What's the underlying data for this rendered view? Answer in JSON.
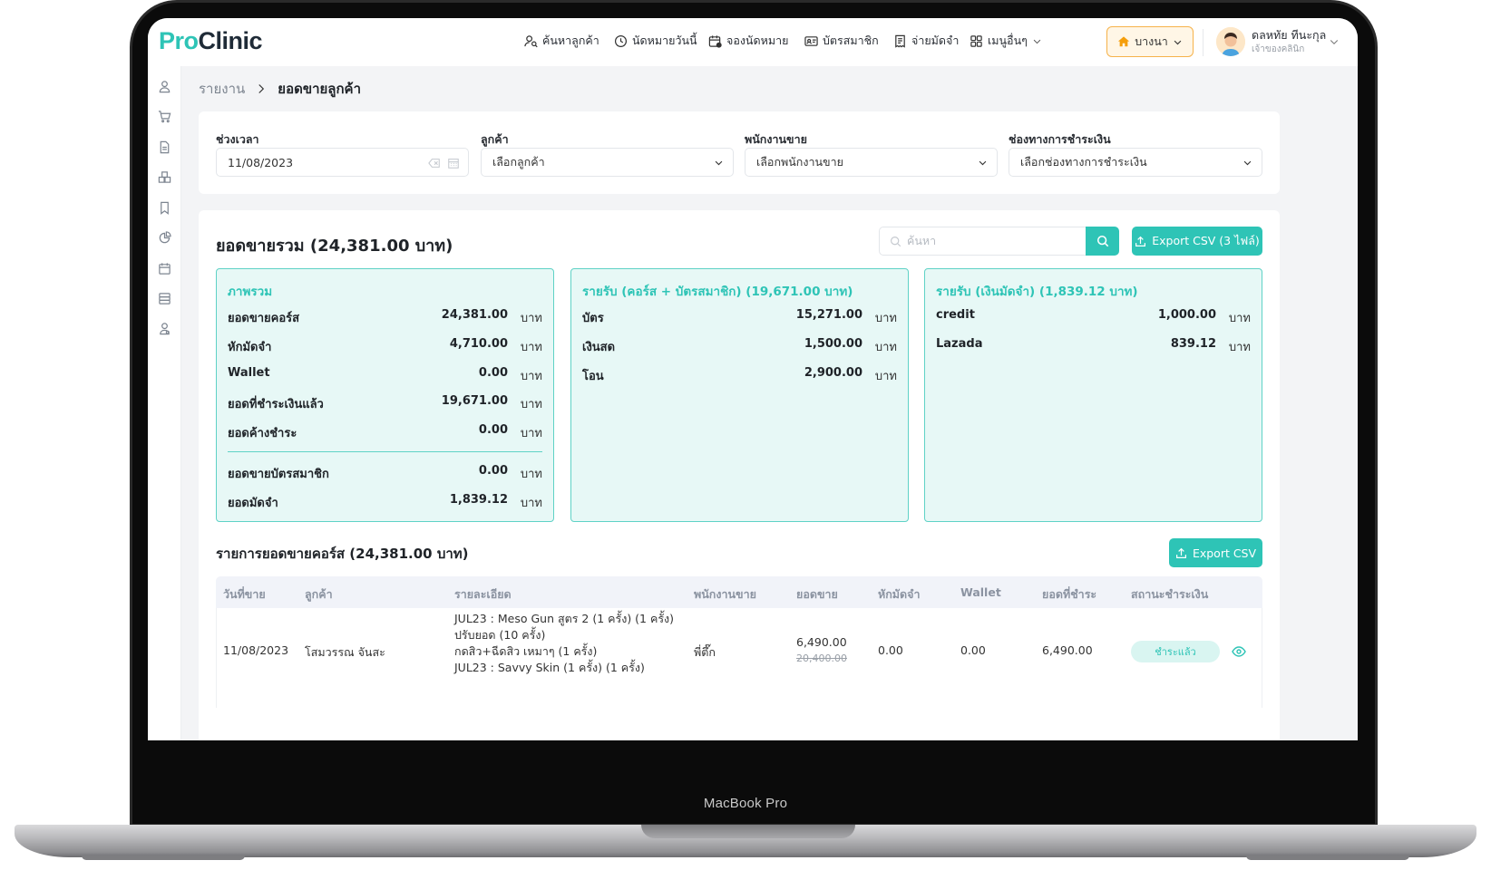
{
  "device": {
    "label": "MacBook Pro"
  },
  "brand": {
    "logo_part1": "Pro",
    "logo_part2": "Clinic",
    "accent_color": "#2ec4b6"
  },
  "nav": {
    "items": [
      {
        "label": "ค้นหาลูกค้า",
        "icon": "user-search-icon"
      },
      {
        "label": "นัดหมายวันนี้",
        "icon": "clock-icon"
      },
      {
        "label": "จองนัดหมาย",
        "icon": "calendar-add-icon"
      },
      {
        "label": "บัตรสมาชิก",
        "icon": "id-card-icon"
      },
      {
        "label": "จ่ายมัดจำ",
        "icon": "receipt-icon"
      },
      {
        "label": "เมนูอื่นๆ",
        "icon": "grid-icon"
      }
    ],
    "branch": "บางนา",
    "user_name": "ดลหทัย ทีนะกุล",
    "user_role": "เจ้าของคลินิก"
  },
  "sidebar": {
    "icons": [
      "user-icon",
      "cart-icon",
      "document-icon",
      "box-icon",
      "bookmark-icon",
      "chart-pie-icon",
      "calendar-icon",
      "database-icon",
      "staff-icon"
    ]
  },
  "breadcrumb": {
    "parent": "รายงาน",
    "current": "ยอดขายลูกค้า"
  },
  "filters": {
    "date_label": "ช่วงเวลา",
    "date_value": "11/08/2023",
    "customer_label": "ลูกค้า",
    "customer_placeholder": "เลือกลูกค้า",
    "staff_label": "พนักงานขาย",
    "staff_placeholder": "เลือกพนักงานขาย",
    "payment_label": "ช่องทางการชำระเงิน",
    "payment_placeholder": "เลือกช่องทางการชำระเงิน"
  },
  "summary": {
    "title": "ยอดขายรวม (24,381.00 บาท)",
    "search_placeholder": "ค้นหา",
    "export_all_label": "Export CSV (3 ไฟล์)",
    "unit": "บาท",
    "overview": {
      "title": "ภาพรวม",
      "rows": [
        {
          "label": "ยอดขายคอร์ส",
          "value": "24,381.00"
        },
        {
          "label": "หักมัดจำ",
          "value": "4,710.00"
        },
        {
          "label": "Wallet",
          "value": "0.00"
        },
        {
          "label": "ยอดที่ชำระเงินแล้ว",
          "value": "19,671.00"
        },
        {
          "label": "ยอดค้างชำระ",
          "value": "0.00"
        },
        {
          "label": "ยอดขายบัตรสมาชิก",
          "value": "0.00"
        },
        {
          "label": "ยอดมัดจำ",
          "value": "1,839.12"
        }
      ]
    },
    "income_course": {
      "title": "รายรับ (คอร์ส + บัตรสมาชิก) (19,671.00 บาท)",
      "rows": [
        {
          "label": "บัตร",
          "value": "15,271.00"
        },
        {
          "label": "เงินสด",
          "value": "1,500.00"
        },
        {
          "label": "โอน",
          "value": "2,900.00"
        }
      ]
    },
    "income_deposit": {
      "title": "รายรับ (เงินมัดจำ) (1,839.12 บาท)",
      "rows": [
        {
          "label": "credit",
          "value": "1,000.00"
        },
        {
          "label": "Lazada",
          "value": "839.12"
        }
      ]
    }
  },
  "course_list": {
    "title": "รายการยอดขายคอร์ส (24,381.00 บาท)",
    "export_label": "Export CSV",
    "columns": [
      "วันที่ขาย",
      "ลูกค้า",
      "รายละเอียด",
      "พนักงานขาย",
      "ยอดขาย",
      "หักมัดจำ",
      "Wallet",
      "ยอดที่ชำระ",
      "สถานะชำระเงิน"
    ],
    "rows": [
      {
        "date": "11/08/2023",
        "customer": "โสมวรรณ จันสะ",
        "details": [
          "JUL23 : Meso Gun สูตร 2 (1 ครั้ง) (1 ครั้ง)",
          "ปรับยอด (10 ครั้ง)",
          "กดสิว+ฉีดสิว เหมาๆ (1 ครั้ง)",
          "JUL23 : Savvy Skin (1 ครั้ง) (1 ครั้ง)"
        ],
        "staff": "พี่ตึ๊ก",
        "sale": "6,490.00",
        "sale_original": "20,400.00",
        "deposit": "0.00",
        "wallet": "0.00",
        "paid": "6,490.00",
        "status": "ชำระแล้ว"
      }
    ]
  }
}
